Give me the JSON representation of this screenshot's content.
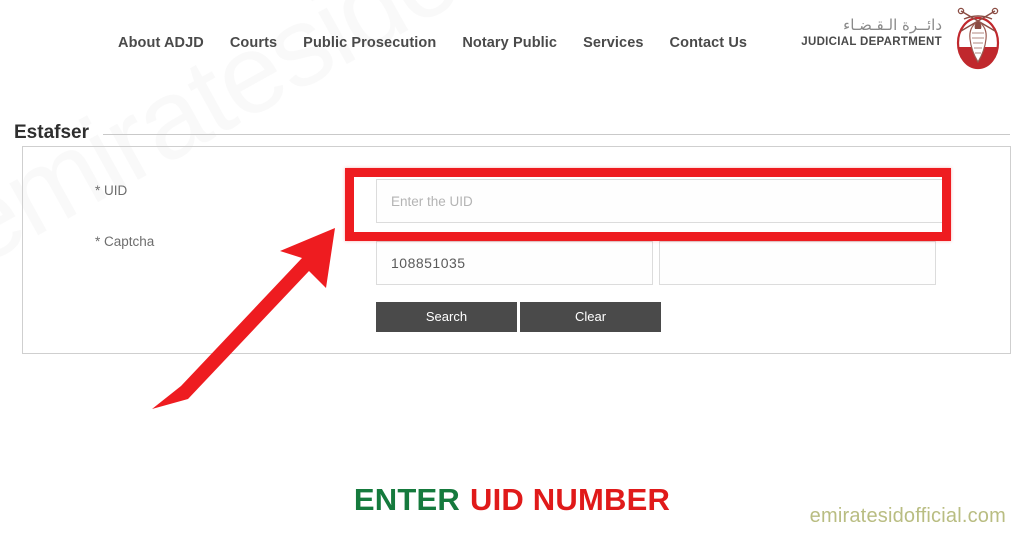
{
  "watermarks": {
    "diagonal_text": "emiratesidofficial.com",
    "corner_text": "emiratesidofficial.com"
  },
  "header": {
    "nav": [
      {
        "label": "About ADJD",
        "name": "nav-about-adjd"
      },
      {
        "label": "Courts",
        "name": "nav-courts"
      },
      {
        "label": "Public Prosecution",
        "name": "nav-public-prosecution"
      },
      {
        "label": "Notary Public",
        "name": "nav-notary-public"
      },
      {
        "label": "Services",
        "name": "nav-services"
      },
      {
        "label": "Contact Us",
        "name": "nav-contact-us"
      }
    ],
    "logo": {
      "arabic": "دائــرة الـقـضـاء",
      "english": "JUDICIAL DEPARTMENT",
      "emblem": "falcon-emblem-icon"
    }
  },
  "page": {
    "section_title": "Estafser"
  },
  "form": {
    "uid": {
      "label": "* UID",
      "placeholder": "Enter the UID",
      "value": ""
    },
    "captcha": {
      "label": "* Captcha",
      "code": "108851035",
      "input_placeholder": "",
      "input_value": ""
    },
    "buttons": {
      "search": "Search",
      "clear": "Clear"
    }
  },
  "annotations": {
    "highlight_box_color": "#ee1c20",
    "arrow_color": "#ee1c20",
    "caption_part1": "ENTER",
    "caption_part2": "UID NUMBER",
    "caption_color1": "#157a3d",
    "caption_color2": "#e01a1a"
  }
}
